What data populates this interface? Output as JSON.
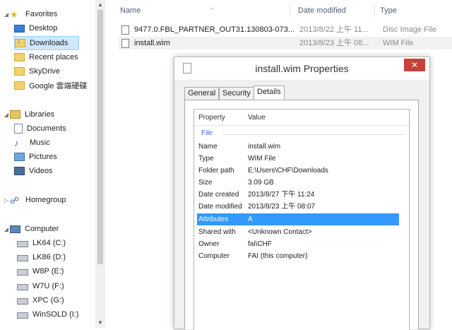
{
  "nav": {
    "favorites": {
      "label": "Favorites",
      "items": [
        {
          "label": "Desktop",
          "icon": "desktop-icon"
        },
        {
          "label": "Downloads",
          "icon": "downloads-icon"
        },
        {
          "label": "Recent places",
          "icon": "recent-places-icon"
        },
        {
          "label": "SkyDrive",
          "icon": "skydrive-icon"
        },
        {
          "label": "Google 雲端硬碟",
          "icon": "google-drive-icon"
        }
      ]
    },
    "libraries": {
      "label": "Libraries",
      "items": [
        {
          "label": "Documents",
          "icon": "documents-icon"
        },
        {
          "label": "Music",
          "icon": "music-icon"
        },
        {
          "label": "Pictures",
          "icon": "pictures-icon"
        },
        {
          "label": "Videos",
          "icon": "videos-icon"
        }
      ]
    },
    "homegroup": {
      "label": "Homegroup"
    },
    "computer": {
      "label": "Computer",
      "drives": [
        {
          "label": "LK64 (C:)"
        },
        {
          "label": "LK86 (D:)"
        },
        {
          "label": "W8P (E:)"
        },
        {
          "label": "W7U (F:)"
        },
        {
          "label": "XPC (G:)"
        },
        {
          "label": "WinSOLD (I:)"
        }
      ]
    },
    "selected_item": "Downloads"
  },
  "filelist": {
    "columns": {
      "name": "Name",
      "date": "Date modified",
      "type": "Type"
    },
    "rows": [
      {
        "name": "9477.0.FBL_PARTNER_OUT31.130803-073...",
        "date": "2013/8/22 上午 11...",
        "type": "Disc Image File"
      },
      {
        "name": "install.wim",
        "date": "2013/8/23 上午 08...",
        "type": "WIM File"
      }
    ]
  },
  "dialog": {
    "title": "install.wim Properties",
    "close_label": "✕",
    "tabs": [
      "General",
      "Security",
      "Details"
    ],
    "active_tab": "Details",
    "header": {
      "property": "Property",
      "value": "Value"
    },
    "group": "File",
    "properties": [
      {
        "name": "Name",
        "value": "install.wim"
      },
      {
        "name": "Type",
        "value": "WIM File"
      },
      {
        "name": "Folder path",
        "value": "E:\\Users\\CHF\\Downloads"
      },
      {
        "name": "Size",
        "value": "3.09 GB"
      },
      {
        "name": "Date created",
        "value": "2013/8/27 下午 11:24"
      },
      {
        "name": "Date modified",
        "value": "2013/8/23 上午 08:07"
      },
      {
        "name": "Attributes",
        "value": "A"
      },
      {
        "name": "Shared with",
        "value": "<Unknown Contact>"
      },
      {
        "name": "Owner",
        "value": "fai\\CHF"
      },
      {
        "name": "Computer",
        "value": "FAI (this computer)"
      }
    ],
    "selected_property": "Attributes"
  },
  "colors": {
    "selection": "#3399ff",
    "nav_selection": "#cde8ff",
    "close": "#c7403a",
    "group_text": "#3a6bd6"
  }
}
